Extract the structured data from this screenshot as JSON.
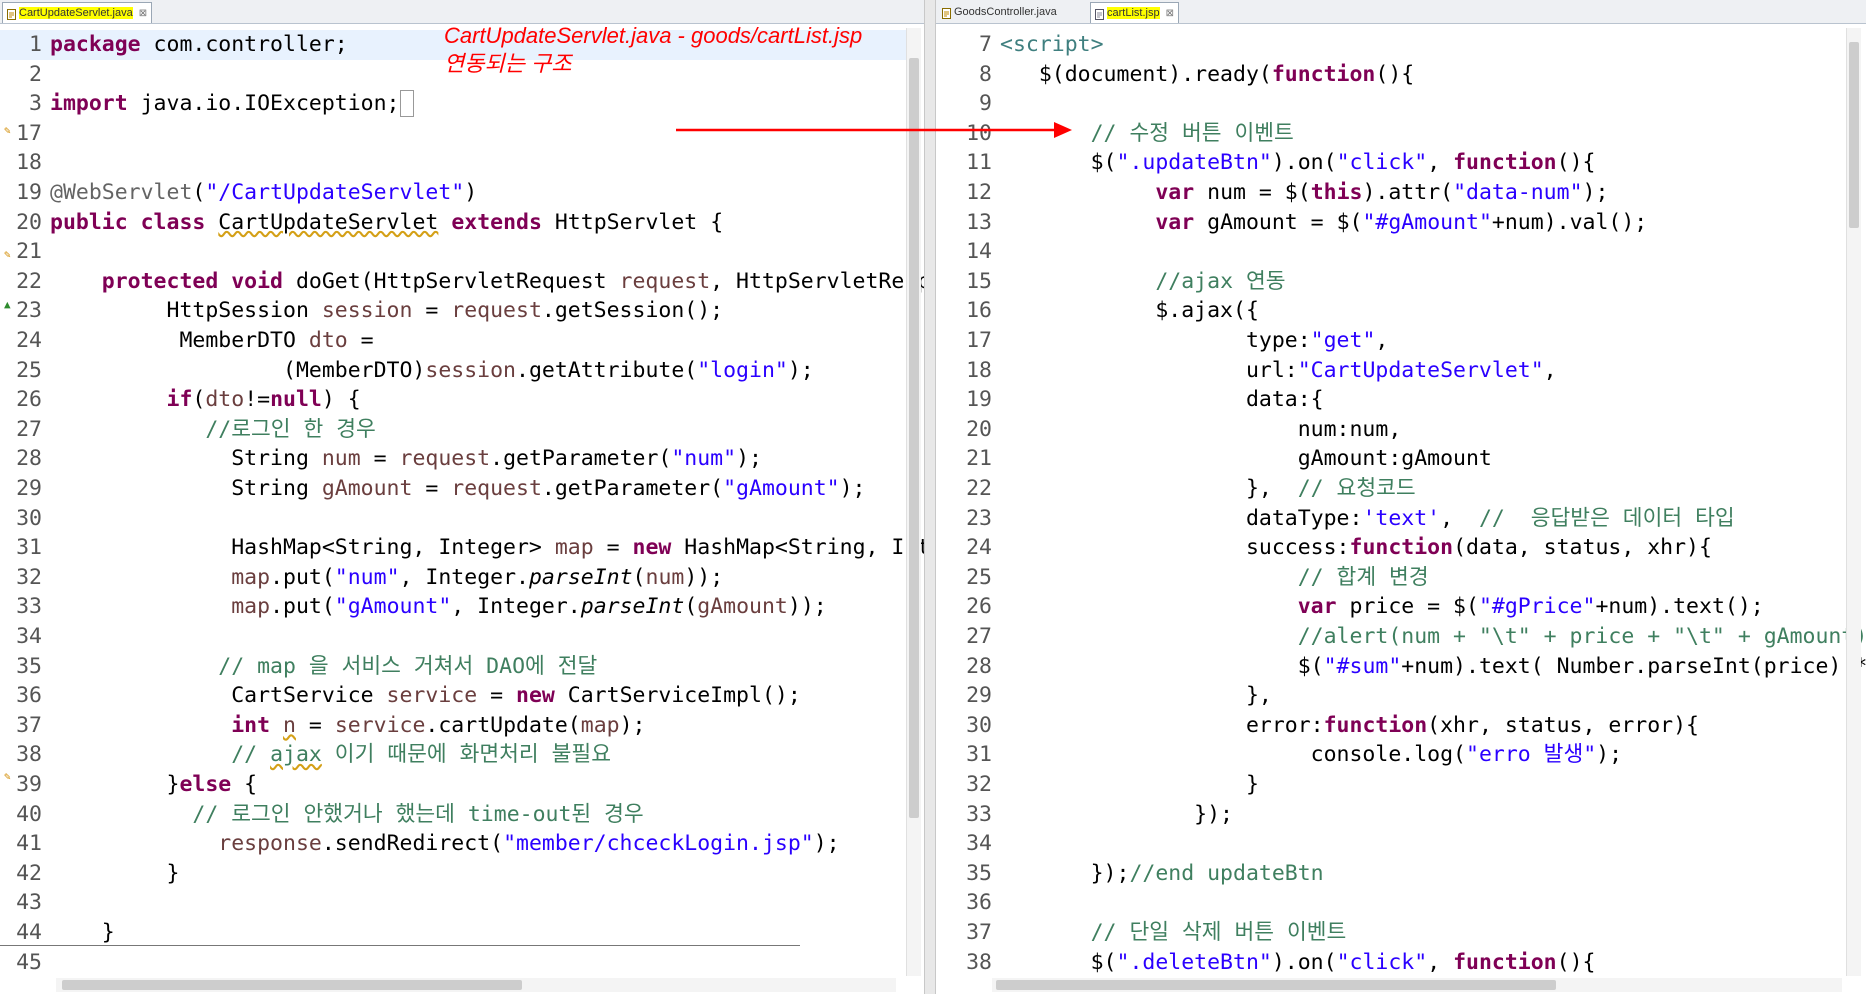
{
  "left_editor": {
    "tab": {
      "label": "CartUpdateServlet.java",
      "close": "⊠"
    },
    "lines": [
      {
        "n": "1",
        "code": "<span class=\"kw\">package</span> com.controller;"
      },
      {
        "n": "2",
        "code": ""
      },
      {
        "n": "3",
        "code": "<span class=\"kw\">import</span> java.io.IOException;<span style=\"border:1px solid #999;\">&#8203; </span>"
      },
      {
        "n": "17",
        "code": ""
      },
      {
        "n": "18",
        "code": ""
      },
      {
        "n": "19",
        "code": "<span class=\"ann\">@WebServlet</span>(<span class=\"str\">\"/CartUpdateServlet\"</span>)"
      },
      {
        "n": "20",
        "code": "<span class=\"kw\">public class</span> <span class=\"u\">CartUpdateServlet</span> <span class=\"kw\">extends</span> HttpServlet {"
      },
      {
        "n": "21",
        "code": ""
      },
      {
        "n": "22",
        "code": "    <span class=\"kw\">protected void</span> doGet(HttpServletRequest <span class=\"loc\">request</span>, HttpServletResponse <span class=\"loc\">response</span>)"
      },
      {
        "n": "23",
        "code": "         HttpSession <span class=\"loc\">session</span> = <span class=\"loc\">request</span>.getSession();"
      },
      {
        "n": "24",
        "code": "          MemberDTO <span class=\"loc\">dto</span> ="
      },
      {
        "n": "25",
        "code": "                  (MemberDTO)<span class=\"loc\">session</span>.getAttribute(<span class=\"str\">\"login\"</span>);"
      },
      {
        "n": "26",
        "code": "         <span class=\"kw\">if</span>(<span class=\"loc\">dto</span>!=<span class=\"kw\">null</span>) {"
      },
      {
        "n": "27",
        "code": "            <span class=\"com\">//로그인 한 경우</span>"
      },
      {
        "n": "28",
        "code": "              String <span class=\"loc\">num</span> = <span class=\"loc\">request</span>.getParameter(<span class=\"str\">\"num\"</span>);"
      },
      {
        "n": "29",
        "code": "              String <span class=\"loc\">gAmount</span> = <span class=\"loc\">request</span>.getParameter(<span class=\"str\">\"gAmount\"</span>);"
      },
      {
        "n": "30",
        "code": ""
      },
      {
        "n": "31",
        "code": "              HashMap&lt;String, Integer&gt; <span class=\"loc\">map</span> = <span class=\"kw\">new</span> HashMap&lt;String, Integer&gt;();"
      },
      {
        "n": "32",
        "code": "              <span class=\"loc\">map</span>.put(<span class=\"str\">\"num\"</span>, Integer.<span class=\"ital\">parseInt</span>(<span class=\"loc\">num</span>));"
      },
      {
        "n": "33",
        "code": "              <span class=\"loc\">map</span>.put(<span class=\"str\">\"gAmount\"</span>, Integer.<span class=\"ital\">parseInt</span>(<span class=\"loc\">gAmount</span>));"
      },
      {
        "n": "34",
        "code": ""
      },
      {
        "n": "35",
        "code": "             <span class=\"com\">// map 을 서비스 거쳐서 DAO에 전달</span>"
      },
      {
        "n": "36",
        "code": "              CartService <span class=\"loc\">service</span> = <span class=\"kw\">new</span> CartServiceImpl();"
      },
      {
        "n": "37",
        "code": "              <span class=\"kw\">int</span> <span class=\"loc u\">n</span> = <span class=\"loc\">service</span>.cartUpdate(<span class=\"loc\">map</span>);"
      },
      {
        "n": "38",
        "code": "              <span class=\"com\">// <span class=\"u\">ajax</span> 이기 때문에 화면처리 불필요</span>"
      },
      {
        "n": "39",
        "code": "         }<span class=\"kw\">else</span> {"
      },
      {
        "n": "40",
        "code": "           <span class=\"com\">// 로그인 안했거나 했는데 time-out된 경우</span>"
      },
      {
        "n": "41",
        "code": "             <span class=\"loc\">response</span>.sendRedirect(<span class=\"str\">\"member/chceckLogin.jsp\"</span>);"
      },
      {
        "n": "42",
        "code": "         }"
      },
      {
        "n": "43",
        "code": ""
      },
      {
        "n": "44",
        "code": "    }"
      },
      {
        "n": "45",
        "code": ""
      }
    ]
  },
  "right_editor": {
    "tabs": [
      {
        "label": "GoodsController.java",
        "close": ""
      },
      {
        "label": "cartList.jsp",
        "close": "⊠"
      }
    ],
    "lines": [
      {
        "n": "7",
        "code": "<span class=\"tag\">&lt;script&gt;</span>"
      },
      {
        "n": "8",
        "code": "   $(document).ready(<span class=\"kw\">function</span>(){"
      },
      {
        "n": "9",
        "code": ""
      },
      {
        "n": "10",
        "code": "       <span class=\"com\">// 수정 버튼 이벤트</span>"
      },
      {
        "n": "11",
        "code": "       $(<span class=\"str\">\".updateBtn\"</span>).on(<span class=\"str\">\"click\"</span>, <span class=\"kw\">function</span>(){"
      },
      {
        "n": "12",
        "code": "            <span class=\"kw\">var</span> num = $(<span class=\"kw\">this</span>).attr(<span class=\"str\">\"data-num\"</span>);"
      },
      {
        "n": "13",
        "code": "            <span class=\"kw\">var</span> gAmount = $(<span class=\"str\">\"#gAmount\"</span>+num).val();"
      },
      {
        "n": "14",
        "code": ""
      },
      {
        "n": "15",
        "code": "            <span class=\"com\">//ajax 연동</span>"
      },
      {
        "n": "16",
        "code": "            $.ajax({"
      },
      {
        "n": "17",
        "code": "                   type:<span class=\"str\">\"get\"</span>,"
      },
      {
        "n": "18",
        "code": "                   url:<span class=\"str\">\"CartUpdateServlet\"</span>,"
      },
      {
        "n": "19",
        "code": "                   data:{"
      },
      {
        "n": "20",
        "code": "                       num:num,"
      },
      {
        "n": "21",
        "code": "                       gAmount:gAmount"
      },
      {
        "n": "22",
        "code": "                   },  <span class=\"com\">// 요청코드</span>"
      },
      {
        "n": "23",
        "code": "                   dataType:<span class=\"str\">'text'</span>,  <span class=\"com\">//  응답받은 데이터 타입</span>"
      },
      {
        "n": "24",
        "code": "                   success:<span class=\"kw\">function</span>(data, status, xhr){"
      },
      {
        "n": "25",
        "code": "                       <span class=\"com\">// 합계 변경</span>"
      },
      {
        "n": "26",
        "code": "                       <span class=\"kw\">var</span> price = $(<span class=\"str\">\"#gPrice\"</span>+num).text();"
      },
      {
        "n": "27",
        "code": "                       <span class=\"com\">//alert(num + \"\\t\" + price + \"\\t\" + gAmount);</span>"
      },
      {
        "n": "28",
        "code": "                       $(<span class=\"str\">\"#sum\"</span>+num).text( Number.parseInt(price) * Number.parseInt(gAmount));"
      },
      {
        "n": "29",
        "code": "                   },"
      },
      {
        "n": "30",
        "code": "                   error:<span class=\"kw\">function</span>(xhr, status, error){"
      },
      {
        "n": "31",
        "code": "                        console.log(<span class=\"str\">\"erro 발생\"</span>);"
      },
      {
        "n": "32",
        "code": "                   }"
      },
      {
        "n": "33",
        "code": "               });"
      },
      {
        "n": "34",
        "code": ""
      },
      {
        "n": "35",
        "code": "       });<span class=\"com\">//end updateBtn</span>"
      },
      {
        "n": "36",
        "code": ""
      },
      {
        "n": "37",
        "code": "       <span class=\"com\">// 단일 삭제 버튼 이벤트</span>"
      },
      {
        "n": "38",
        "code": "       $(<span class=\"str\">\".deleteBtn\"</span>).on(<span class=\"str\">\"click\"</span>, <span class=\"kw\">function</span>(){"
      }
    ]
  },
  "annotation": {
    "text": "CartUpdateServlet.java - goods/cartList.jsp\n연동되는 구조",
    "color": "#ff0000"
  },
  "colors": {
    "keyword": "#7f0055",
    "string": "#2a00ff",
    "comment": "#3f7f5f",
    "local_var": "#6a3e3e",
    "tag": "#3f7f7f"
  }
}
